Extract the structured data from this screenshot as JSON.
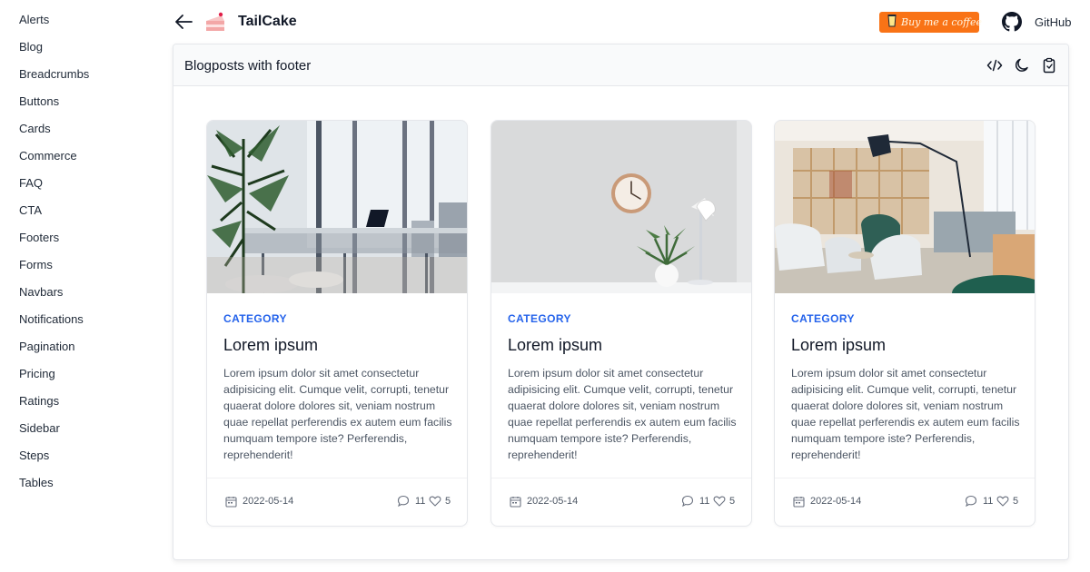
{
  "sidebar": {
    "items": [
      {
        "label": "Alerts"
      },
      {
        "label": "Blog"
      },
      {
        "label": "Breadcrumbs"
      },
      {
        "label": "Buttons"
      },
      {
        "label": "Cards"
      },
      {
        "label": "Commerce"
      },
      {
        "label": "FAQ"
      },
      {
        "label": "CTA"
      },
      {
        "label": "Footers"
      },
      {
        "label": "Forms"
      },
      {
        "label": "Navbars"
      },
      {
        "label": "Notifications"
      },
      {
        "label": "Pagination"
      },
      {
        "label": "Pricing"
      },
      {
        "label": "Ratings"
      },
      {
        "label": "Sidebar"
      },
      {
        "label": "Steps"
      },
      {
        "label": "Tables"
      }
    ]
  },
  "header": {
    "brand": "TailCake",
    "coffee_label": "Buy me a coffee",
    "github_label": "GitHub"
  },
  "panel": {
    "title": "Blogposts with footer",
    "tools": [
      "code-icon",
      "moon-icon",
      "clipboard-icon"
    ]
  },
  "cards": [
    {
      "category": "CATEGORY",
      "title": "Lorem ipsum",
      "text": "Lorem ipsum dolor sit amet consectetur adipisicing elit. Cumque velit, corrupti, tenetur quaerat dolore dolores sit, veniam nostrum quae repellat perferendis ex autem eum facilis numquam tempore iste? Perferendis, reprehenderit!",
      "date": "2022-05-14",
      "comments": "11",
      "likes": "5",
      "image": "office-plant-window"
    },
    {
      "category": "CATEGORY",
      "title": "Lorem ipsum",
      "text": "Lorem ipsum dolor sit amet consectetur adipisicing elit. Cumque velit, corrupti, tenetur quaerat dolore dolores sit, veniam nostrum quae repellat perferendis ex autem eum facilis numquam tempore iste? Perferendis, reprehenderit!",
      "date": "2022-05-14",
      "comments": "11",
      "likes": "5",
      "image": "wall-clock-desk"
    },
    {
      "category": "CATEGORY",
      "title": "Lorem ipsum",
      "text": "Lorem ipsum dolor sit amet consectetur adipisicing elit. Cumque velit, corrupti, tenetur quaerat dolore dolores sit, veniam nostrum quae repellat perferendis ex autem eum facilis numquam tempore iste? Perferendis, reprehenderit!",
      "date": "2022-05-14",
      "comments": "11",
      "likes": "5",
      "image": "lounge-chairs-lamp"
    }
  ],
  "colors": {
    "accent": "#2563eb",
    "coffee": "#f97316",
    "panel_header": "#f9fafb"
  }
}
